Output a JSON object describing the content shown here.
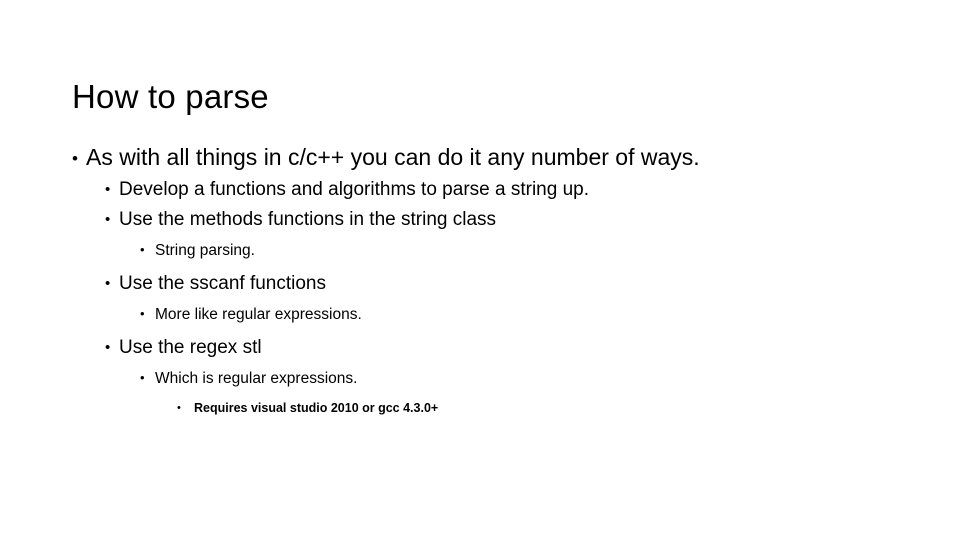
{
  "slide": {
    "title": "How to parse",
    "background_color": "#ffffff",
    "text_color": "#000000",
    "bullet_glyph": "•",
    "outline": [
      {
        "level": 1,
        "bullet": "•",
        "text": "As with all things in c/c++ you can do it any number of ways."
      },
      {
        "level": 2,
        "bullet": "•",
        "text": "Develop a functions and algorithms to parse a string up."
      },
      {
        "level": 2,
        "bullet": "•",
        "text": "Use the methods functions in the string class"
      },
      {
        "level": 3,
        "bullet": "•",
        "text": "String parsing."
      },
      {
        "level": 2,
        "bullet": "•",
        "text": "Use the sscanf functions"
      },
      {
        "level": 3,
        "bullet": "•",
        "text": "More like regular expressions."
      },
      {
        "level": 2,
        "bullet": "•",
        "text": "Use the regex stl"
      },
      {
        "level": 3,
        "bullet": "•",
        "text": "Which is regular expressions."
      },
      {
        "level": 4,
        "bullet": "•",
        "text": "Requires visual studio 2010 or gcc 4.3.0+"
      }
    ]
  }
}
